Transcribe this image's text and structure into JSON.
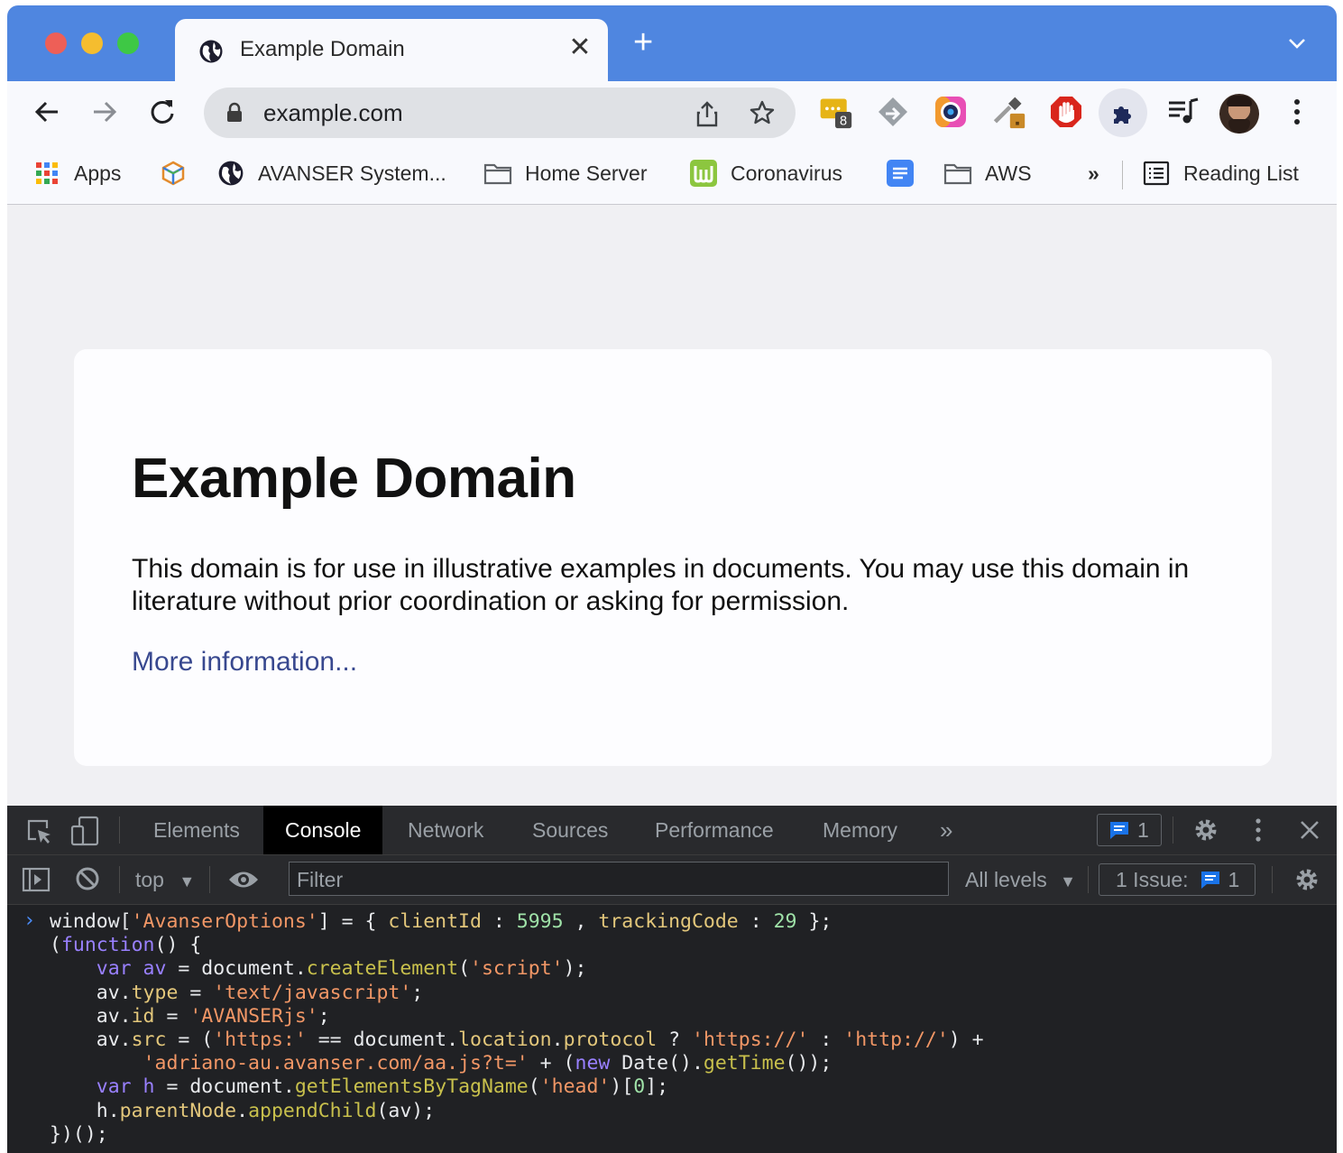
{
  "browser": {
    "tab": {
      "title": "Example Domain",
      "close_glyph": "✕",
      "icon": "globe-icon"
    },
    "new_tab_glyph": "+",
    "address_bar": {
      "url": "example.com"
    },
    "extension_badge": "8",
    "bookmarks": [
      {
        "label": "Apps",
        "icon": "apps-grid-icon"
      },
      {
        "label": "",
        "icon": "cube-icon"
      },
      {
        "label": "AVANSER System...",
        "icon": "globe-icon"
      },
      {
        "label": "Home Server",
        "icon": "folder-icon"
      },
      {
        "label": "Coronavirus",
        "icon": "w-logo-icon"
      },
      {
        "label": "",
        "icon": "docs-icon"
      },
      {
        "label": "AWS",
        "icon": "folder-icon"
      }
    ],
    "bookmarks_overflow": "»",
    "reading_list": "Reading List"
  },
  "page": {
    "heading": "Example Domain",
    "paragraph": "This domain is for use in illustrative examples in documents. You may use this domain in literature without prior coordination or asking for permission.",
    "link": "More information..."
  },
  "devtools": {
    "tabs": [
      "Elements",
      "Console",
      "Network",
      "Sources",
      "Performance",
      "Memory"
    ],
    "active_tab": "Console",
    "overflow": "»",
    "messages_count": "1",
    "context": "top",
    "filter_placeholder": "Filter",
    "levels": "All levels",
    "issues_label": "1 Issue:",
    "issues_count": "1"
  },
  "console_prompt": "›",
  "colors": {
    "tabstrip": "#4f86e0",
    "link": "#38488f",
    "console_keyword": "#9980ff",
    "console_string": "#f29766",
    "console_property": "#e3c77b",
    "console_number": "#9fe2a8"
  }
}
